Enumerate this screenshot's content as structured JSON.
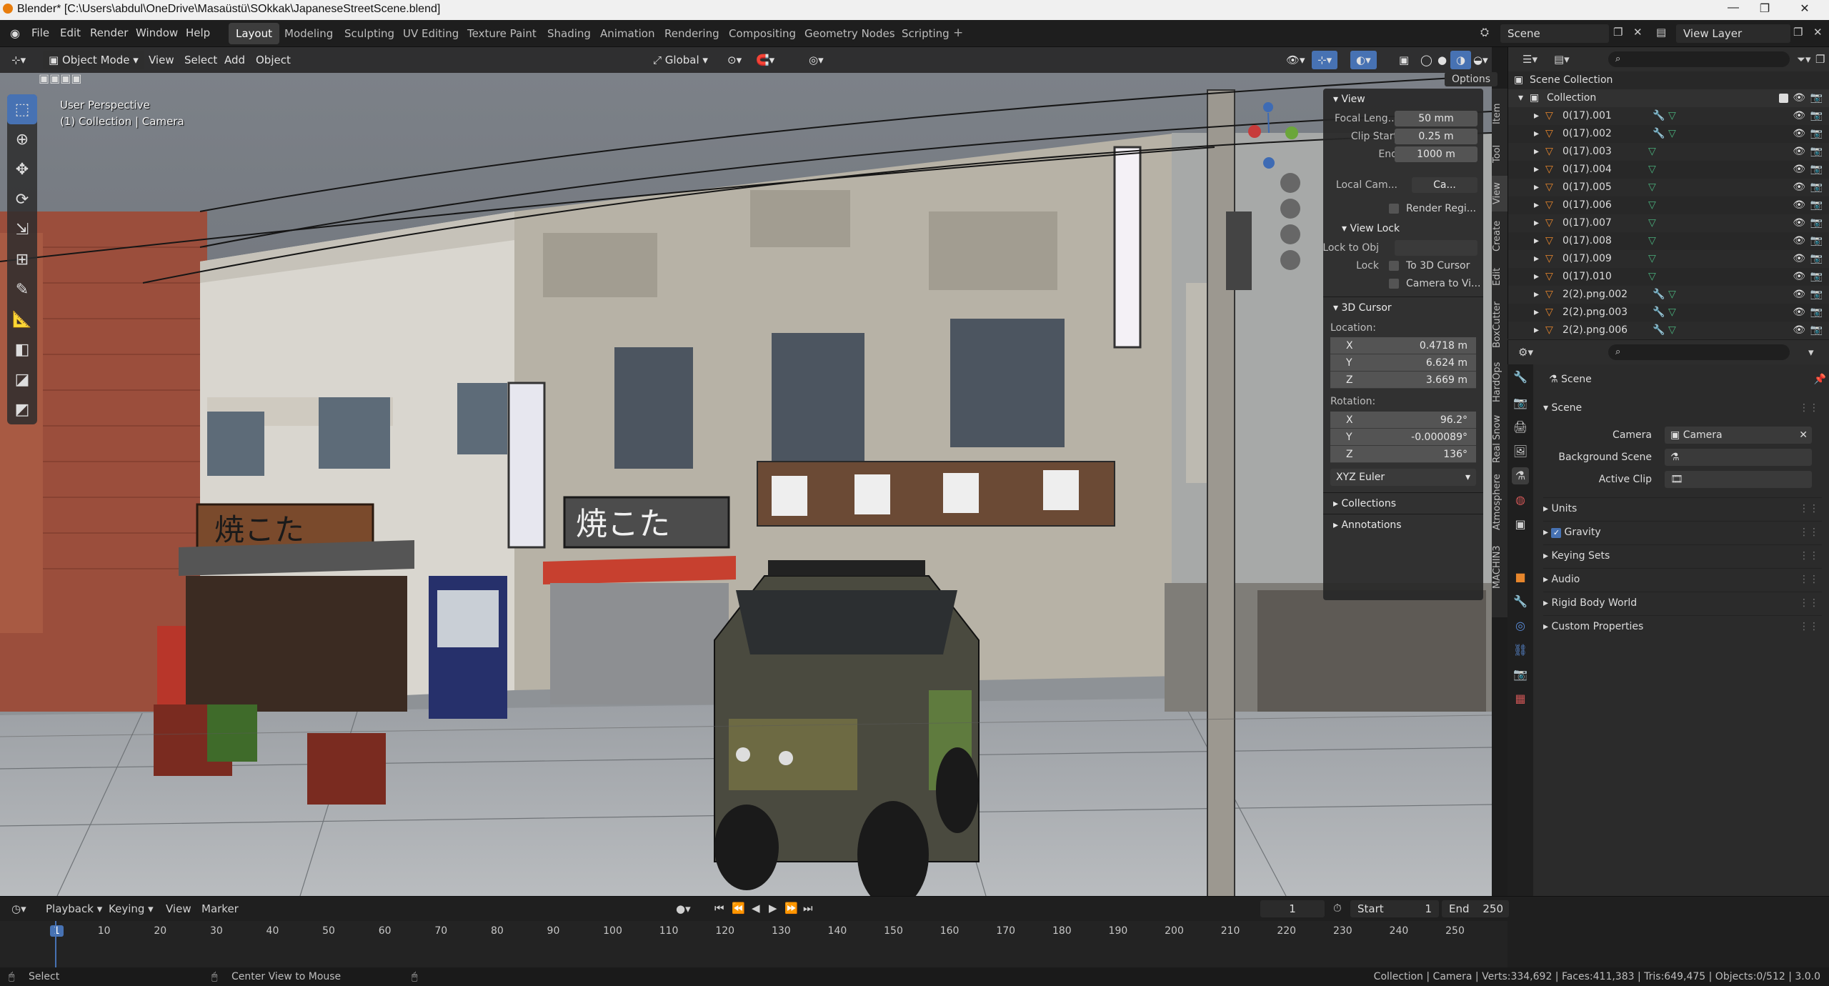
{
  "window": {
    "title": "Blender* [C:\\Users\\abdul\\OneDrive\\Masaüstü\\SOkkak\\JapaneseStreetScene.blend]"
  },
  "menus": [
    "File",
    "Edit",
    "Render",
    "Window",
    "Help"
  ],
  "workspaces": [
    "Layout",
    "Modeling",
    "Sculpting",
    "UV Editing",
    "Texture Paint",
    "Shading",
    "Animation",
    "Rendering",
    "Compositing",
    "Geometry Nodes",
    "Scripting"
  ],
  "active_workspace": "Layout",
  "scene_field": "Scene",
  "view_layer_field": "View Layer",
  "viewport_header": {
    "mode": "Object Mode",
    "view": "View",
    "select": "Select",
    "add": "Add",
    "object": "Object",
    "transform": "Global",
    "options": "Options"
  },
  "viewport_overlay": {
    "line1": "User Perspective",
    "line2": "(1) Collection | Camera"
  },
  "npanel": {
    "view_header": "View",
    "focal_label": "Focal Leng...",
    "focal_value": "50 mm",
    "clip_start_label": "Clip Start",
    "clip_start_value": "0.25 m",
    "end_label": "End",
    "end_value": "1000 m",
    "local_cam_label": "Local Cam...",
    "local_cam_value": "Ca...",
    "render_region": "Render Regi...",
    "view_lock": "View Lock",
    "lock_to_obj": "Lock to Obj",
    "lock": "Lock",
    "to_3d_cursor": "To 3D Cursor",
    "camera_to_view": "Camera to Vi...",
    "cursor_header": "3D Cursor",
    "location_label": "Location:",
    "loc_x": "0.4718 m",
    "loc_y": "6.624 m",
    "loc_z": "3.669 m",
    "rotation_label": "Rotation:",
    "rot_x": "96.2°",
    "rot_y": "-0.000089°",
    "rot_z": "136°",
    "rot_mode": "XYZ Euler",
    "collections": "Collections",
    "annotations": "Annotations",
    "x": "X",
    "y": "Y",
    "z": "Z"
  },
  "side_tabs": [
    "Item",
    "Tool",
    "View",
    "Create",
    "Edit",
    "BoxCutter",
    "HardOps",
    "Real Snow",
    "Atmosphere",
    "MACHIN3"
  ],
  "outliner": {
    "scene_collection": "Scene Collection",
    "collection": "Collection",
    "items": [
      "0(17).001",
      "0(17).002",
      "0(17).003",
      "0(17).004",
      "0(17).005",
      "0(17).006",
      "0(17).007",
      "0(17).008",
      "0(17).009",
      "0(17).010",
      "2(2).png.002",
      "2(2).png.003",
      "2(2).png.006"
    ]
  },
  "properties": {
    "breadcrumb": "Scene",
    "panel": "Scene",
    "camera_label": "Camera",
    "camera_value": "Camera",
    "background_scene_label": "Background Scene",
    "active_clip_label": "Active Clip",
    "subpanels": [
      "Units",
      "Gravity",
      "Keying Sets",
      "Audio",
      "Rigid Body World",
      "Custom Properties"
    ]
  },
  "timeline": {
    "playback": "Playback",
    "keying": "Keying",
    "view": "View",
    "marker": "Marker",
    "current_frame": "1",
    "start_label": "Start",
    "start_value": "1",
    "end_label": "End",
    "end_value": "250",
    "ticks": [
      "1",
      "10",
      "20",
      "30",
      "40",
      "50",
      "60",
      "70",
      "80",
      "90",
      "100",
      "110",
      "120",
      "130",
      "140",
      "150",
      "160",
      "170",
      "180",
      "190",
      "200",
      "210",
      "220",
      "230",
      "240",
      "250"
    ]
  },
  "status": {
    "select": "Select",
    "center_view": "Center View to Mouse",
    "stats": "Collection | Camera | Verts:334,692 | Faces:411,383 | Tris:649,475 | Objects:0/512 | 3.0.0"
  },
  "colors": {
    "accent": "#4772b3",
    "background": "#1d1d1d",
    "panel": "#282828"
  }
}
